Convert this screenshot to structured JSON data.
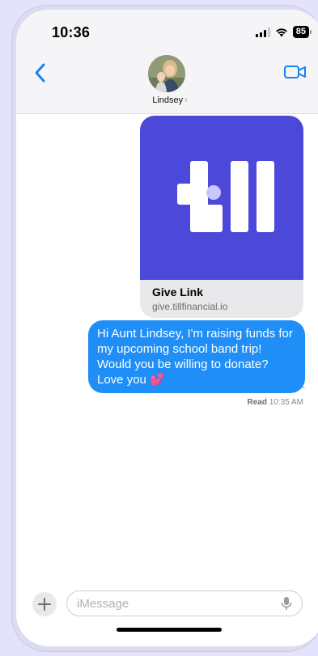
{
  "status_bar": {
    "time": "10:36",
    "battery": "85"
  },
  "nav": {
    "contact_name": "Lindsey",
    "chevron": "›"
  },
  "link_preview": {
    "title": "Give Link",
    "domain": "give.tillfinancial.io",
    "brand_color": "#4c48d9"
  },
  "message": {
    "text": "Hi Aunt Lindsey, I'm raising funds for my upcoming school band trip! Would you be willing to donate? Love you 💕",
    "bubble_color": "#1f8ef6",
    "read_label": "Read",
    "read_time": "10:35 AM"
  },
  "composer": {
    "placeholder": "iMessage"
  },
  "icons": [
    "back-chevron-icon",
    "video-camera-icon",
    "plus-icon",
    "microphone-icon",
    "wifi-icon",
    "signal-icon",
    "battery-icon",
    "till-logo"
  ]
}
